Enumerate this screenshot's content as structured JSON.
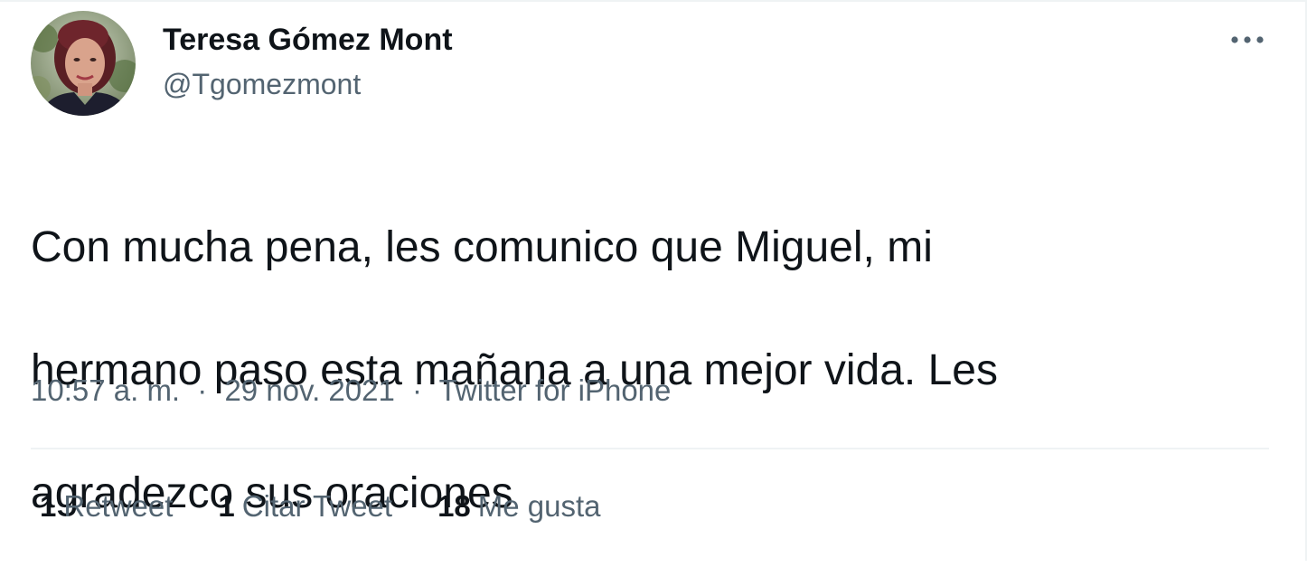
{
  "author": {
    "display_name": "Teresa Gómez Mont",
    "handle": "@Tgomezmont",
    "avatar_icon": "profile-photo"
  },
  "tweet": {
    "text_lines": [
      "Con mucha pena, les comunico que Miguel, mi",
      "hermano paso esta mañana a una mejor vida. Les",
      "agradezco sus oraciones"
    ],
    "time": "10:57 a. m.",
    "date": "29 nov. 2021",
    "separator": "·",
    "source": "Twitter for iPhone"
  },
  "more_menu": {
    "icon": "more-horizontal-icon"
  },
  "stats": {
    "retweets": {
      "count": "1",
      "label": "Retweet"
    },
    "quotes": {
      "count": "1",
      "label": "Citar Tweet"
    },
    "likes": {
      "count": "18",
      "label": "Me gusta"
    }
  },
  "colors": {
    "primary_text": "#0f1419",
    "secondary_text": "#536471",
    "divider": "#eff3f4",
    "background": "#ffffff"
  }
}
